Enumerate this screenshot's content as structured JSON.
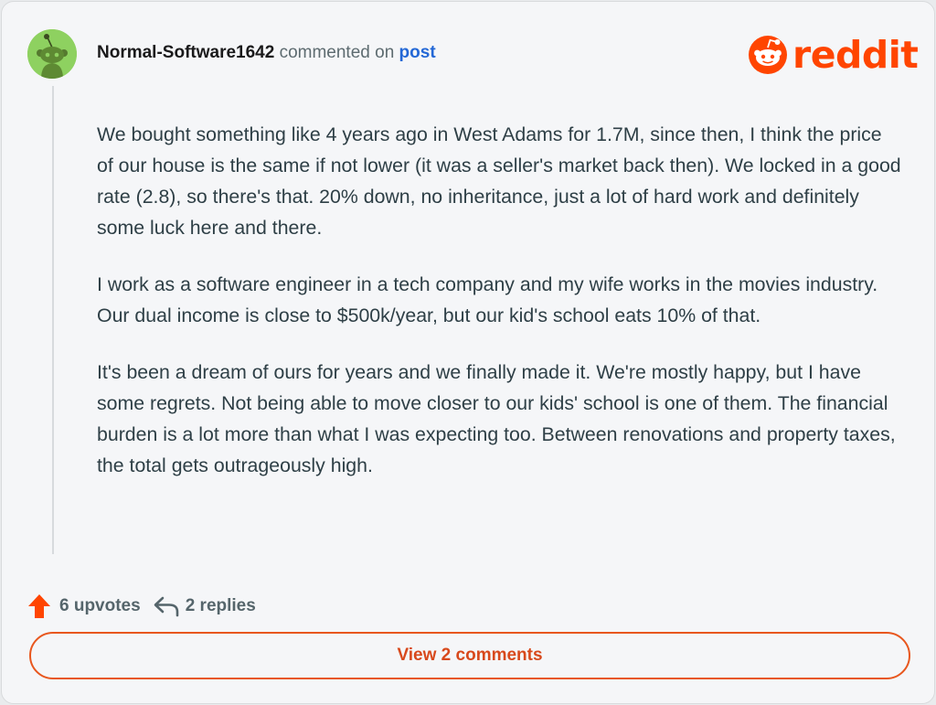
{
  "comment": {
    "username": "Normal-Software1642",
    "action_text": "commented on",
    "post_link": "post",
    "paragraphs": [
      "We bought something like 4 years ago in West Adams for 1.7M, since then, I think the price of our house is the same if not lower (it was a seller's market back then). We locked in a good rate (2.8), so there's that. 20% down, no inheritance, just a lot of hard work and definitely some luck here and there.",
      "I work as a software engineer in a tech company and my wife works in the movies industry. Our dual income is close to $500k/year, but our kid's school eats 10% of that.",
      "It's been a dream of ours for years and we finally made it. We're mostly happy, but I have some regrets. Not being able to move closer to our kids' school is one of them. The financial burden is a lot more than what I was expecting too. Between renovations and property taxes, the total gets outrageously high."
    ]
  },
  "brand": {
    "wordmark": "reddit",
    "color": "#ff4500",
    "icon": "reddit-snoo-icon"
  },
  "actions": {
    "upvotes_label": "6 upvotes",
    "upvote_icon": "upvote-arrow-icon",
    "upvote_color": "#ff4500",
    "replies_label": "2 replies",
    "reply_icon": "reply-arrow-icon"
  },
  "view_comments_label": "View 2 comments",
  "avatar": {
    "icon": "snoo-avatar-icon",
    "background": "#8ed160"
  }
}
